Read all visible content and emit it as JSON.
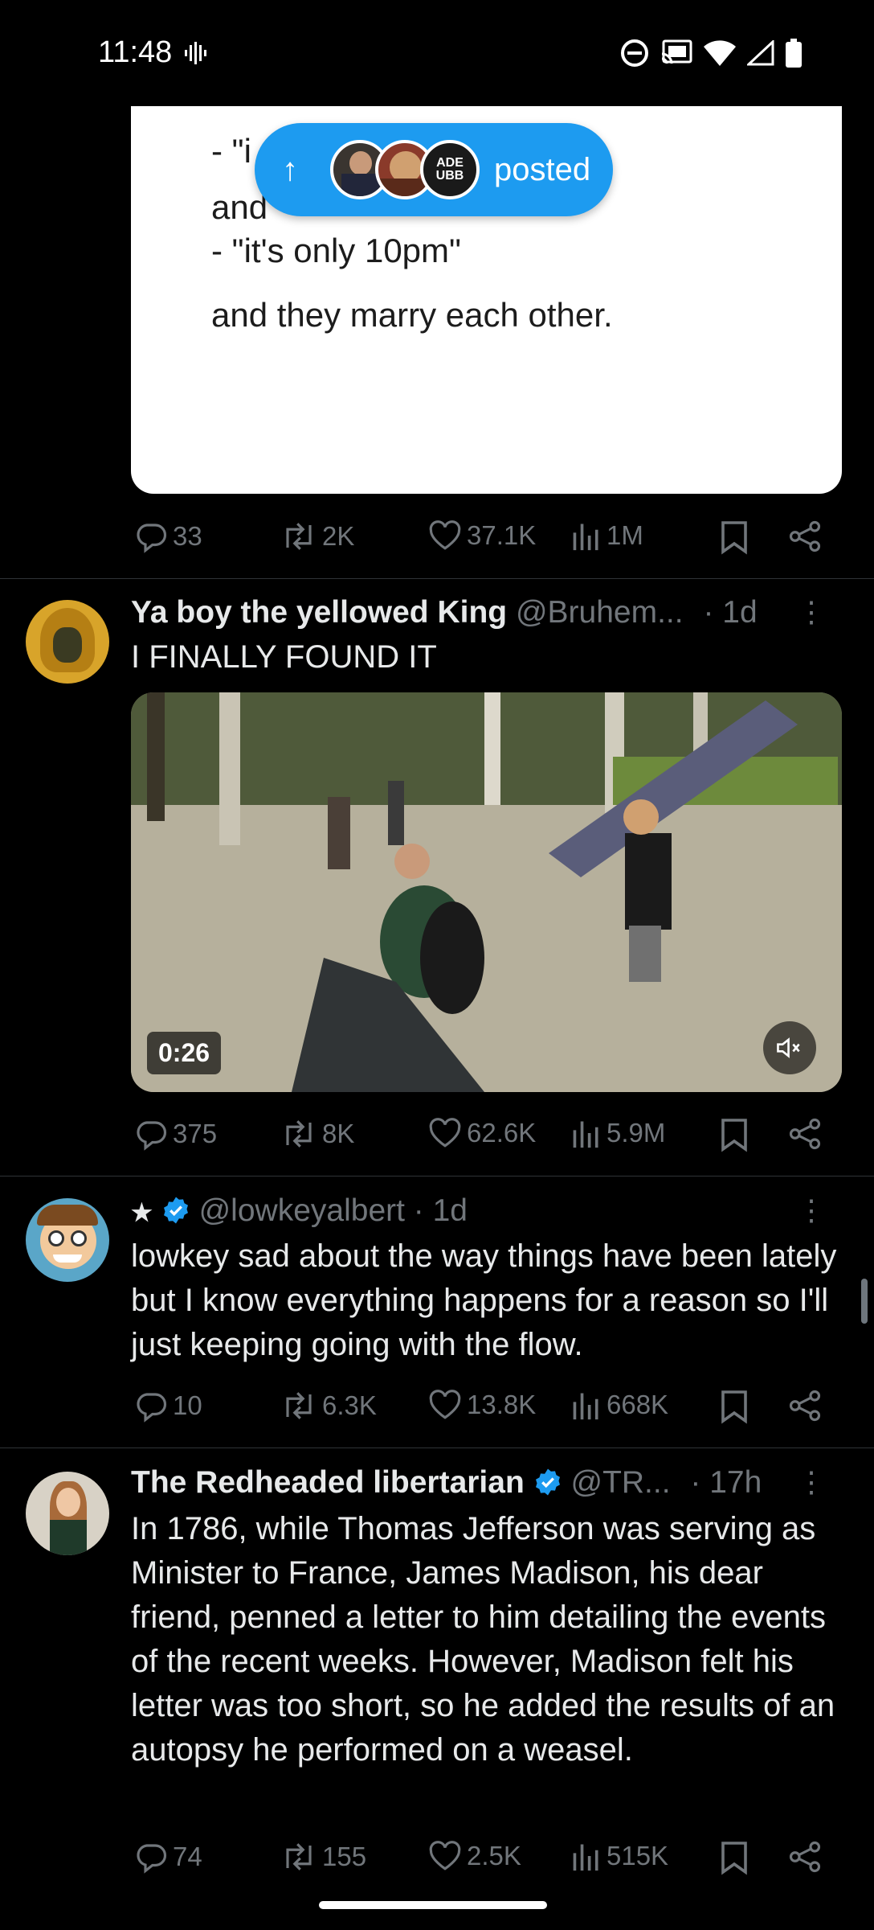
{
  "status_bar": {
    "time": "11:48"
  },
  "top_card": {
    "lines": [
      "- \"i",
      "and",
      "- \"it's only 10pm\"",
      "and they marry each other."
    ]
  },
  "posted_pill": {
    "label": "posted",
    "avatar3_text": "ADE\nUBB"
  },
  "tweet0": {
    "stats": {
      "replies": "33",
      "reposts": "2K",
      "likes": "37.1K",
      "views": "1M"
    }
  },
  "tweet1": {
    "name": "Ya boy the yellowed King",
    "handle": "@Bruhem...",
    "time": "· 1d",
    "text": "I FINALLY FOUND IT",
    "video_duration": "0:26",
    "stats": {
      "replies": "375",
      "reposts": "8K",
      "likes": "62.6K",
      "views": "5.9M"
    }
  },
  "tweet2": {
    "name": "★",
    "handle": "@lowkeyalbert · 1d",
    "text": "lowkey sad about the way things have been lately but I know everything happens for a reason so I'll just keeping going with the flow.",
    "stats": {
      "replies": "10",
      "reposts": "6.3K",
      "likes": "13.8K",
      "views": "668K"
    }
  },
  "tweet3": {
    "name": "The Redheaded libertarian",
    "handle": "@TR...",
    "time": "· 17h",
    "text": "In 1786, while Thomas Jefferson was serving as Minister to France, James Madison, his dear friend, penned a letter to him detailing the events of the recent weeks. However, Madison felt his letter was too short, so he added the results of an autopsy he performed on a weasel.",
    "stats": {
      "replies": "74",
      "reposts": "155",
      "likes": "2.5K",
      "views": "515K"
    }
  },
  "colors": {
    "accent": "#1d9bf0",
    "muted": "#71767b",
    "background": "#000000"
  }
}
